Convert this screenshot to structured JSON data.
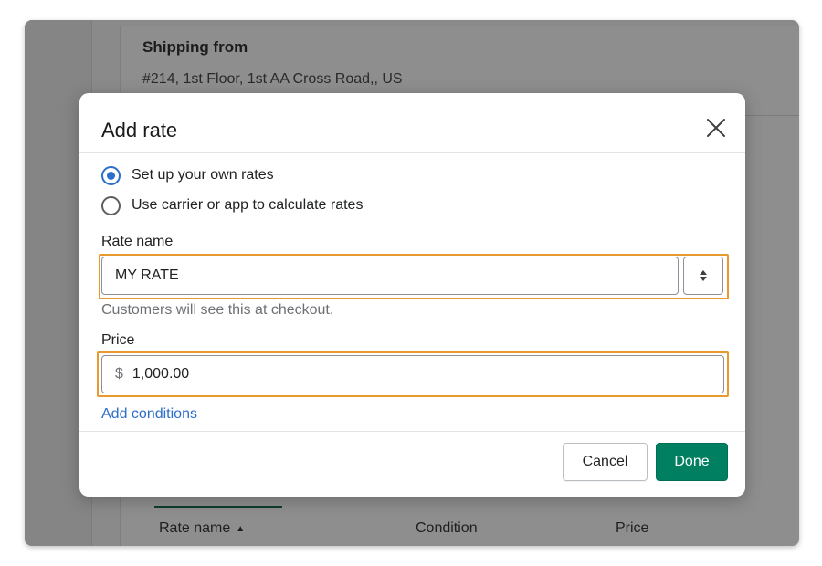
{
  "background": {
    "shipping_title": "Shipping from",
    "shipping_address": "#214, 1st Floor, 1st AA Cross Road,, US",
    "table_headers": [
      "Rate name",
      "Condition",
      "Price"
    ]
  },
  "modal": {
    "title": "Add rate",
    "close_icon": "close-icon",
    "radio_options": [
      {
        "label": "Set up your own rates",
        "checked": true
      },
      {
        "label": "Use carrier or app to calculate rates",
        "checked": false
      }
    ],
    "rate_name": {
      "label": "Rate name",
      "value": "MY RATE",
      "help": "Customers will see this at checkout."
    },
    "price": {
      "label": "Price",
      "currency_prefix": "$",
      "value": "1,000.00"
    },
    "add_conditions_label": "Add conditions",
    "cancel_label": "Cancel",
    "done_label": "Done"
  },
  "colors": {
    "accent": "#2c6ecb",
    "primary_button": "#008060",
    "highlight": "#e89a2e"
  }
}
